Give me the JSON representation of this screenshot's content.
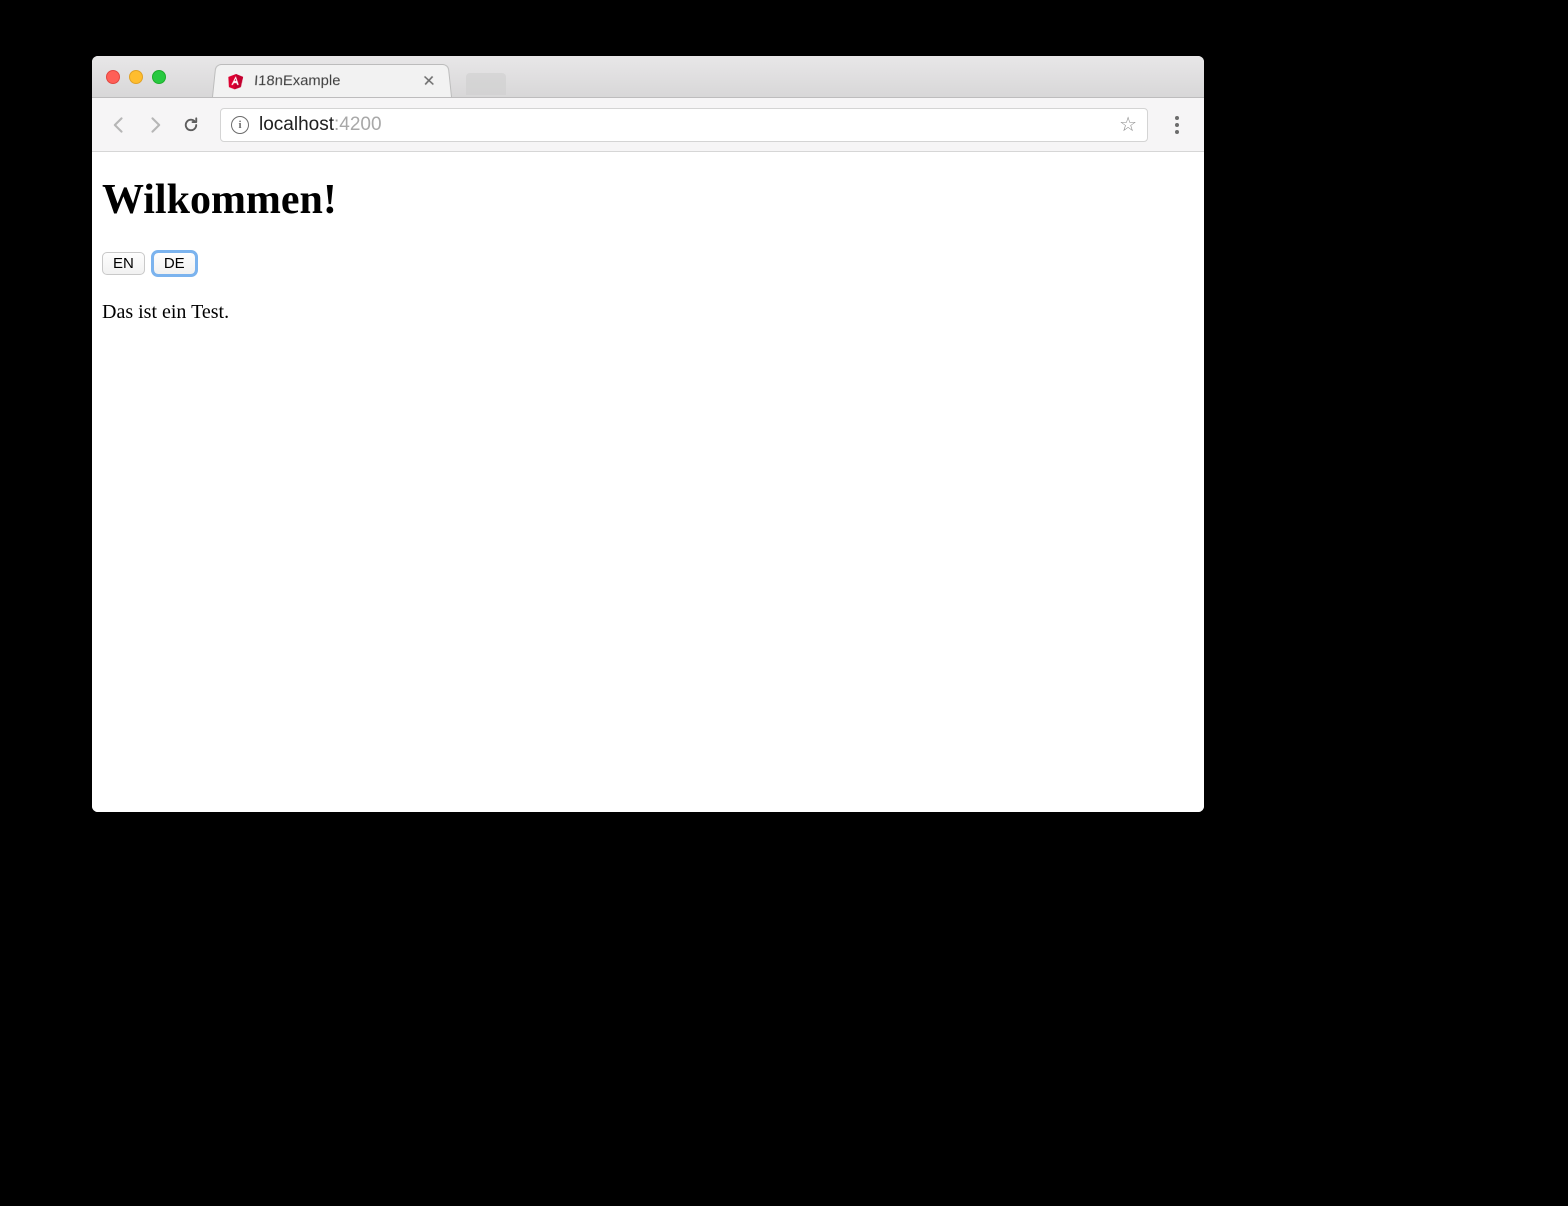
{
  "browser": {
    "tab_title": "I18nExample",
    "url_host": "localhost",
    "url_port": ":4200"
  },
  "page": {
    "heading": "Wilkommen!",
    "buttons": {
      "en": "EN",
      "de": "DE"
    },
    "body_text": "Das ist ein Test."
  }
}
